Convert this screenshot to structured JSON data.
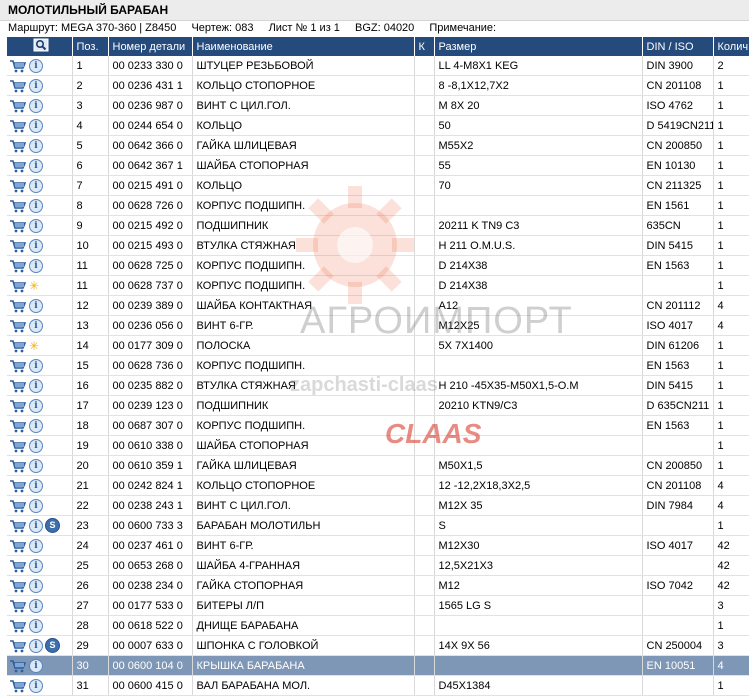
{
  "page_title": "МОЛОТИЛЬНЫЙ БАРАБАН",
  "meta": {
    "route": "Маршрут: MEGA 370-360 | Z8450",
    "drawing": "Чертеж: 083",
    "sheet": "Лист № 1 из 1",
    "bgz": "BGZ: 04020",
    "note": "Примечание:"
  },
  "columns": {
    "search_icon": "search-icon",
    "pos": "Поз.",
    "part_no": "Номер детали",
    "name": "Наименование",
    "k": "К",
    "size": "Размер",
    "din": "DIN / ISO",
    "qty": "Колич..."
  },
  "rows": [
    {
      "pos": "1",
      "part_no": "00 0233 330 0",
      "name": "ШТУЦЕР РЕЗЬБОВОЙ",
      "k": "",
      "size": "LL 4-M8X1 KEG",
      "din": "DIN 3900",
      "qty": "2",
      "icon": "info"
    },
    {
      "pos": "2",
      "part_no": "00 0236 431 1",
      "name": "КОЛЬЦО СТОПОРНОЕ",
      "k": "",
      "size": "8 -8,1X12,7X2",
      "din": "CN 201108",
      "qty": "1",
      "icon": "info"
    },
    {
      "pos": "3",
      "part_no": "00 0236 987 0",
      "name": "ВИНТ С ЦИЛ.ГОЛ.",
      "k": "",
      "size": "M 8X 20",
      "din": "ISO 4762",
      "qty": "1",
      "icon": "info"
    },
    {
      "pos": "4",
      "part_no": "00 0244 654 0",
      "name": "КОЛЬЦО",
      "k": "",
      "size": "50",
      "din": "D 5419CN211",
      "qty": "1",
      "icon": "info"
    },
    {
      "pos": "5",
      "part_no": "00 0642 366 0",
      "name": "ГАЙКА ШЛИЦЕВАЯ",
      "k": "",
      "size": "M55X2",
      "din": "CN 200850",
      "qty": "1",
      "icon": "info"
    },
    {
      "pos": "6",
      "part_no": "00 0642 367 1",
      "name": "ШАЙБА СТОПОРНАЯ",
      "k": "",
      "size": "55",
      "din": "EN 10130",
      "qty": "1",
      "icon": "info"
    },
    {
      "pos": "7",
      "part_no": "00 0215 491 0",
      "name": "КОЛЬЦО",
      "k": "",
      "size": "70",
      "din": "CN 211325",
      "qty": "1",
      "icon": "info"
    },
    {
      "pos": "8",
      "part_no": "00 0628 726 0",
      "name": "КОРПУС ПОДШИПН.",
      "k": "",
      "size": "",
      "din": "EN 1561",
      "qty": "1",
      "icon": "info"
    },
    {
      "pos": "9",
      "part_no": "00 0215 492 0",
      "name": "ПОДШИПНИК",
      "k": "",
      "size": "20211 K TN9 C3",
      "din": "635CN",
      "qty": "1",
      "icon": "info"
    },
    {
      "pos": "10",
      "part_no": "00 0215 493 0",
      "name": "ВТУЛКА СТЯЖНАЯ",
      "k": "",
      "size": "H 211 O.M.U.S.",
      "din": "DIN 5415",
      "qty": "1",
      "icon": "info"
    },
    {
      "pos": "11",
      "part_no": "00 0628 725 0",
      "name": "КОРПУС ПОДШИПН.",
      "k": "",
      "size": "D 214X38",
      "din": "EN 1563",
      "qty": "1",
      "icon": "info"
    },
    {
      "pos": "11",
      "part_no": "00 0628 737 0",
      "name": "КОРПУС ПОДШИПН.",
      "k": "",
      "size": "D 214X38",
      "din": "",
      "qty": "1",
      "icon": "star"
    },
    {
      "pos": "12",
      "part_no": "00 0239 389 0",
      "name": "ШАЙБА КОНТАКТНАЯ",
      "k": "",
      "size": "A12",
      "din": "CN 201112",
      "qty": "4",
      "icon": "info"
    },
    {
      "pos": "13",
      "part_no": "00 0236 056 0",
      "name": "ВИНТ 6-ГР.",
      "k": "",
      "size": "M12X25",
      "din": "ISO 4017",
      "qty": "4",
      "icon": "info"
    },
    {
      "pos": "14",
      "part_no": "00 0177 309 0",
      "name": "ПОЛОСКА",
      "k": "",
      "size": "5X 7X1400",
      "din": "DIN 61206",
      "qty": "1",
      "icon": "star"
    },
    {
      "pos": "15",
      "part_no": "00 0628 736 0",
      "name": "КОРПУС ПОДШИПН.",
      "k": "",
      "size": "",
      "din": "EN 1563",
      "qty": "1",
      "icon": "info"
    },
    {
      "pos": "16",
      "part_no": "00 0235 882 0",
      "name": "ВТУЛКА СТЯЖНАЯ",
      "k": "",
      "size": "H 210 -45X35-M50X1,5-O.M",
      "din": "DIN 5415",
      "qty": "1",
      "icon": "info"
    },
    {
      "pos": "17",
      "part_no": "00 0239 123 0",
      "name": "ПОДШИПНИК",
      "k": "",
      "size": "20210 KTN9/C3",
      "din": "D 635CN211",
      "qty": "1",
      "icon": "info"
    },
    {
      "pos": "18",
      "part_no": "00 0687 307 0",
      "name": "КОРПУС ПОДШИПН.",
      "k": "",
      "size": "",
      "din": "EN 1563",
      "qty": "1",
      "icon": "info"
    },
    {
      "pos": "19",
      "part_no": "00 0610 338 0",
      "name": "ШАЙБА СТОПОРНАЯ",
      "k": "",
      "size": "",
      "din": "",
      "qty": "1",
      "icon": "info"
    },
    {
      "pos": "20",
      "part_no": "00 0610 359 1",
      "name": "ГАЙКА ШЛИЦЕВАЯ",
      "k": "",
      "size": "M50X1,5",
      "din": "CN 200850",
      "qty": "1",
      "icon": "info"
    },
    {
      "pos": "21",
      "part_no": "00 0242 824 1",
      "name": "КОЛЬЦО СТОПОРНОЕ",
      "k": "",
      "size": "12 -12,2X18,3X2,5",
      "din": "CN 201108",
      "qty": "4",
      "icon": "info"
    },
    {
      "pos": "22",
      "part_no": "00 0238 243 1",
      "name": "ВИНТ С ЦИЛ.ГОЛ.",
      "k": "",
      "size": "M12X 35",
      "din": "DIN 7984",
      "qty": "4",
      "icon": "info"
    },
    {
      "pos": "23",
      "part_no": "00 0600 733 3",
      "name": "БАРАБАН МОЛОТИЛЬН",
      "k": "",
      "size": "S",
      "din": "",
      "qty": "1",
      "icon": "info",
      "s_badge": "S"
    },
    {
      "pos": "24",
      "part_no": "00 0237 461 0",
      "name": "ВИНТ 6-ГР.",
      "k": "",
      "size": "M12X30",
      "din": "ISO 4017",
      "qty": "42",
      "icon": "info"
    },
    {
      "pos": "25",
      "part_no": "00 0653 268 0",
      "name": "ШАЙБА 4-ГРАННАЯ",
      "k": "",
      "size": "12,5X21X3",
      "din": "",
      "qty": "42",
      "icon": "info"
    },
    {
      "pos": "26",
      "part_no": "00 0238 234 0",
      "name": "ГАЙКА СТОПОРНАЯ",
      "k": "",
      "size": "M12",
      "din": "ISO 7042",
      "qty": "42",
      "icon": "info"
    },
    {
      "pos": "27",
      "part_no": "00 0177 533 0",
      "name": "БИТЕРЫ Л/П",
      "k": "",
      "size": "1565 LG        S",
      "din": "",
      "qty": "3",
      "icon": "info"
    },
    {
      "pos": "28",
      "part_no": "00 0618 522 0",
      "name": "ДНИЩЕ БАРАБАНА",
      "k": "",
      "size": "",
      "din": "",
      "qty": "1",
      "icon": "info"
    },
    {
      "pos": "29",
      "part_no": "00 0007 633 0",
      "name": "ШПОНКА С ГОЛОВКОЙ",
      "k": "",
      "size": "14X 9X 56",
      "din": "CN 250004",
      "qty": "3",
      "icon": "info",
      "s_badge": "S"
    },
    {
      "pos": "30",
      "part_no": "00 0600 104 0",
      "name": "КРЫШКА БАРАБАНА",
      "k": "",
      "size": "",
      "din": "EN 10051",
      "qty": "4",
      "icon": "info",
      "selected": true
    },
    {
      "pos": "31",
      "part_no": "00 0600 415 0",
      "name": "ВАЛ БАРАБАНА МОЛ.",
      "k": "",
      "size": "D45X1384",
      "din": "",
      "qty": "1",
      "icon": "info"
    }
  ],
  "watermark": {
    "line1": "АГРОИМПОРТ",
    "line2": "zapchasti-claas",
    "line3": "CLAAS"
  },
  "colors": {
    "header_bg": "#254a7c",
    "selected_row": "#7f97b6",
    "cart_icon": "#2d5f9e",
    "star_icon": "#f2b400"
  }
}
